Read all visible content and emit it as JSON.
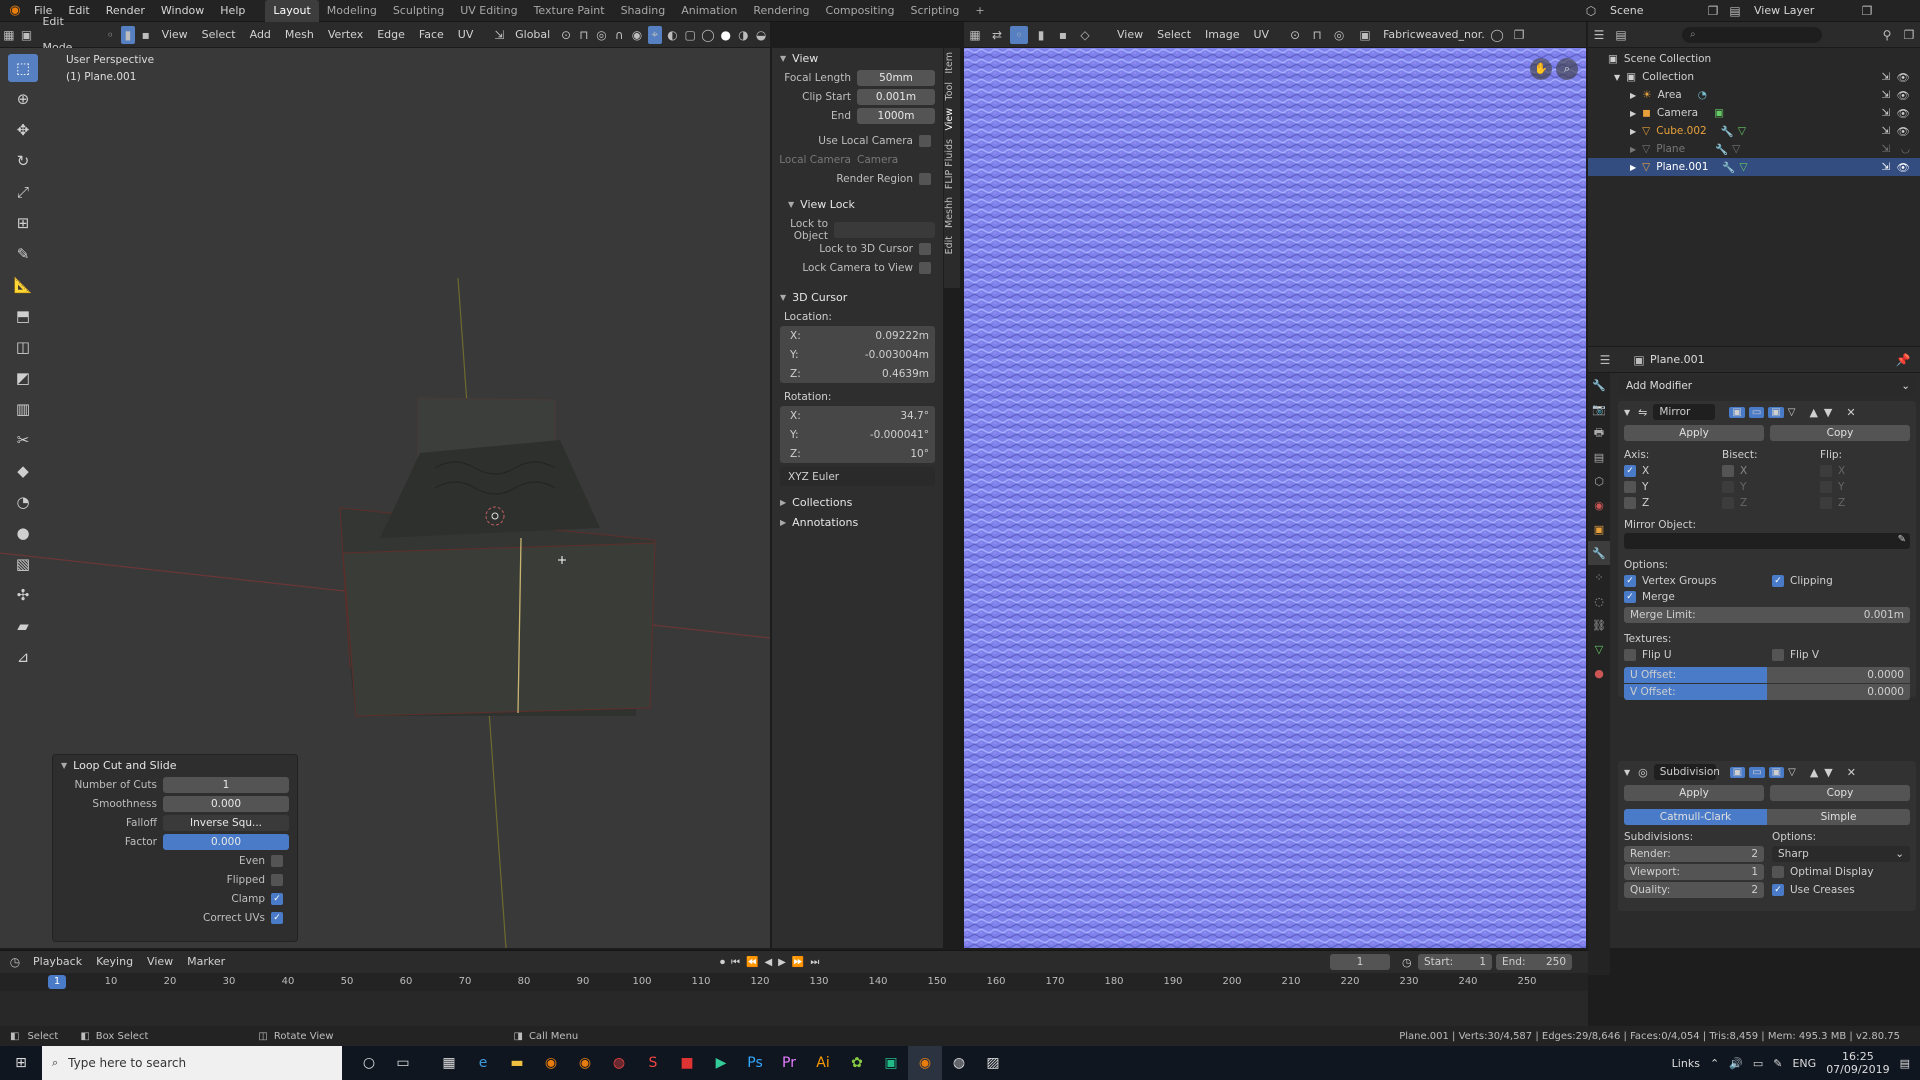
{
  "topbar": {
    "menus": [
      "File",
      "Edit",
      "Render",
      "Window",
      "Help"
    ],
    "workspaces": [
      "Layout",
      "Modeling",
      "Sculpting",
      "UV Editing",
      "Texture Paint",
      "Shading",
      "Animation",
      "Rendering",
      "Compositing",
      "Scripting"
    ],
    "add_tab": "+",
    "scene_label": "Scene",
    "view_layer_label": "View Layer"
  },
  "viewport_header": {
    "mode": "Edit Mode",
    "menus": [
      "View",
      "Select",
      "Add",
      "Mesh",
      "Vertex",
      "Edge",
      "Face",
      "UV"
    ],
    "orientation": "Global"
  },
  "viewport": {
    "perspective": "User Perspective",
    "object": "(1) Plane.001"
  },
  "npanel": {
    "view_title": "View",
    "focal_length_label": "Focal Length",
    "focal_length": "50mm",
    "clip_start_label": "Clip Start",
    "clip_start": "0.001m",
    "end_label": "End",
    "end": "1000m",
    "use_local_camera": "Use Local Camera",
    "local_camera_label": "Local Camera",
    "local_camera_value": "Camera",
    "render_region": "Render Region",
    "view_lock_title": "View Lock",
    "lock_to_object": "Lock to Object",
    "lock_to_3d_cursor": "Lock to 3D Cursor",
    "lock_camera_to_view": "Lock Camera to View",
    "cursor_title": "3D Cursor",
    "location_label": "Location:",
    "loc_x_label": "X:",
    "loc_x": "0.09222m",
    "loc_y_label": "Y:",
    "loc_y": "-0.003004m",
    "loc_z_label": "Z:",
    "loc_z": "0.4639m",
    "rotation_label": "Rotation:",
    "rot_x_label": "X:",
    "rot_x": "34.7°",
    "rot_y_label": "Y:",
    "rot_y": "-0.000041°",
    "rot_z_label": "Z:",
    "rot_z": "10°",
    "rotation_mode": "XYZ Euler",
    "collections": "Collections",
    "annotations": "Annotations",
    "tabs": [
      "Item",
      "Tool",
      "View",
      "FLIP Fluids",
      "Meshh",
      "Edit"
    ]
  },
  "operator_panel": {
    "title": "Loop Cut and Slide",
    "cuts_label": "Number of Cuts",
    "cuts": "1",
    "smoothness_label": "Smoothness",
    "smoothness": "0.000",
    "falloff_label": "Falloff",
    "falloff": "Inverse Squ...",
    "factor_label": "Factor",
    "factor": "0.000",
    "even": "Even",
    "flipped": "Flipped",
    "clamp": "Clamp",
    "correct_uvs": "Correct UVs"
  },
  "image_editor_header": {
    "menus": [
      "View",
      "Select",
      "Image",
      "UV"
    ],
    "image_name": "Fabricweaved_nor..."
  },
  "outliner": {
    "root": "Scene Collection",
    "collection": "Collection",
    "items": [
      "Area",
      "Camera",
      "Cube.002",
      "Plane",
      "Plane.001"
    ]
  },
  "properties": {
    "object_name": "Plane.001",
    "add_modifier": "Add Modifier",
    "mirror": {
      "name": "Mirror",
      "apply": "Apply",
      "copy": "Copy",
      "axis_label": "Axis:",
      "bisect_label": "Bisect:",
      "flip_label": "Flip:",
      "x": "X",
      "y": "Y",
      "z": "Z",
      "mirror_object_label": "Mirror Object:",
      "options_label": "Options:",
      "vertex_groups": "Vertex Groups",
      "clipping": "Clipping",
      "merge": "Merge",
      "merge_limit_label": "Merge Limit:",
      "merge_limit": "0.001m",
      "textures_label": "Textures:",
      "flip_u": "Flip U",
      "flip_v": "Flip V",
      "u_offset_label": "U Offset:",
      "u_offset": "0.0000",
      "v_offset_label": "V Offset:",
      "v_offset": "0.0000"
    },
    "subdivision": {
      "name": "Subdivision",
      "apply": "Apply",
      "copy": "Copy",
      "catmull": "Catmull-Clark",
      "simple": "Simple",
      "subdivisions_label": "Subdivisions:",
      "options_label": "Options:",
      "render_label": "Render:",
      "render": "2",
      "viewport_label": "Viewport:",
      "viewport": "1",
      "quality_label": "Quality:",
      "quality": "2",
      "uv_mode": "Sharp",
      "optimal_display": "Optimal Display",
      "use_creases": "Use Creases"
    }
  },
  "timeline": {
    "menus": [
      "Playback",
      "Keying",
      "View",
      "Marker"
    ],
    "current_frame": "1",
    "start_label": "Start:",
    "start": "1",
    "end_label": "End:",
    "end": "250",
    "ticks": [
      "1",
      "10",
      "20",
      "30",
      "40",
      "50",
      "60",
      "70",
      "80",
      "90",
      "100",
      "110",
      "120",
      "130",
      "140",
      "150",
      "160",
      "170",
      "180",
      "190",
      "200",
      "210",
      "220",
      "230",
      "240",
      "250"
    ]
  },
  "statusbar": {
    "select": "Select",
    "box_select": "Box Select",
    "rotate_view": "Rotate View",
    "call_menu": "Call Menu",
    "stats": "Plane.001 | Verts:30/4,587 | Edges:29/8,646 | Faces:0/4,054 | Tris:8,459 | Mem: 495.3 MB | v2.80.75"
  },
  "taskbar": {
    "search_placeholder": "Type here to search",
    "links": "Links",
    "lang": "ENG",
    "time": "16:25",
    "date": "07/09/2019"
  },
  "colors": {
    "accent": "#4a7bc8",
    "normal_map": "#7a7fe8",
    "cube_orange": "#e8a13a"
  }
}
